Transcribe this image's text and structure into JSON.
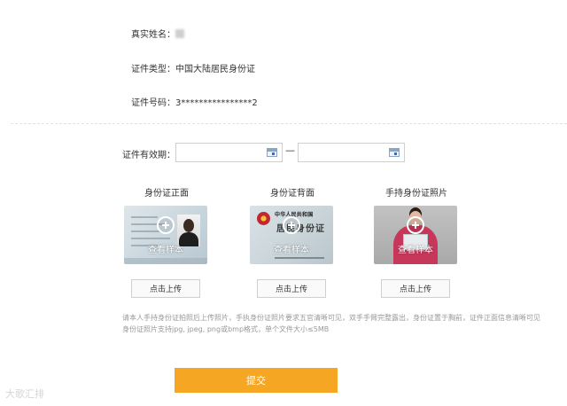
{
  "profile": {
    "real_name_label": "真实姓名：",
    "id_type_label": "证件类型：",
    "id_type_value": "中国大陆居民身份证",
    "id_number_label": "证件号码：",
    "id_number_value": "3****************2"
  },
  "validity": {
    "label": "证件有效期：",
    "separator": "—",
    "start_value": "",
    "end_value": ""
  },
  "cards": [
    {
      "title": "身份证正面",
      "sample_label": "查看样本",
      "upload_label": "点击上传"
    },
    {
      "title": "身份证背面",
      "sample_label": "查看样本",
      "upload_label": "点击上传"
    },
    {
      "title": "手持身份证照片",
      "sample_label": "查看样本",
      "upload_label": "点击上传"
    }
  ],
  "back_card": {
    "country_text": "中华人民共和国",
    "card_text": "居民身份证"
  },
  "note": {
    "line1": "请本人手持身份证拍照后上传照片，手执身份证照片要求五官清晰可见，双手手臂完整露出，身份证置于胸前，证件正面信息清晰可见",
    "line2": "身份证照片支持jpg, jpeg, png或bmp格式，单个文件大小≤5MB"
  },
  "submit_label": "提交",
  "watermark": "大歌汇排",
  "colors": {
    "submit": "#f5a623",
    "note": "#999999"
  }
}
